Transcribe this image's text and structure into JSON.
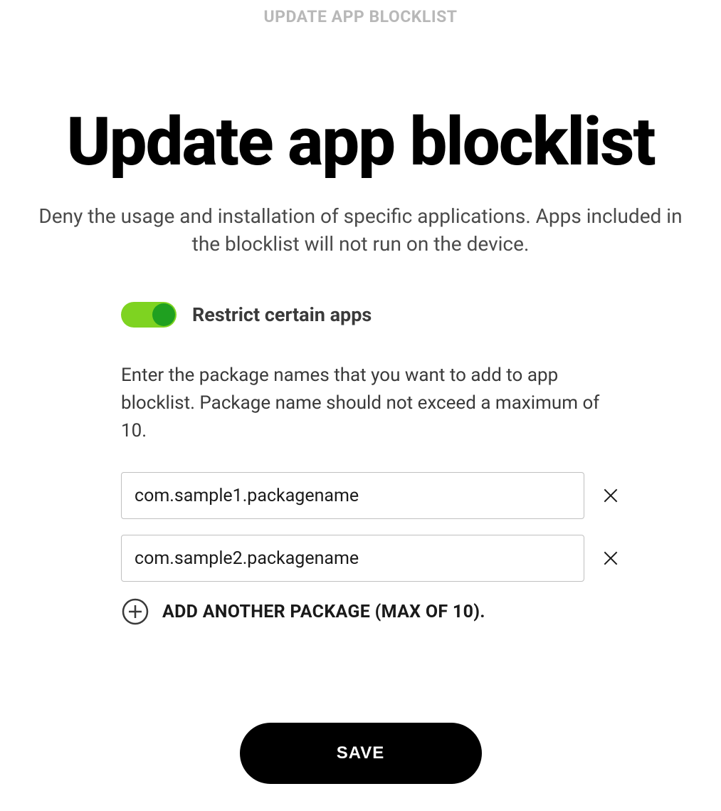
{
  "header": {
    "label": "UPDATE APP BLOCKLIST"
  },
  "page": {
    "title": "Update app blocklist",
    "description": "Deny the usage and installation of specific applications. Apps included in the blocklist will not run on the device."
  },
  "form": {
    "toggle": {
      "enabled": true,
      "label": "Restrict certain apps"
    },
    "instruction": "Enter the package names that you want to add to app blocklist. Package name should not exceed a maximum of 10.",
    "packages": [
      {
        "value": "com.sample1.packagename"
      },
      {
        "value": "com.sample2.packagename"
      }
    ],
    "add_label": "ADD ANOTHER PACKAGE (MAX OF 10).",
    "max_packages": 10
  },
  "actions": {
    "save_label": "SAVE"
  }
}
